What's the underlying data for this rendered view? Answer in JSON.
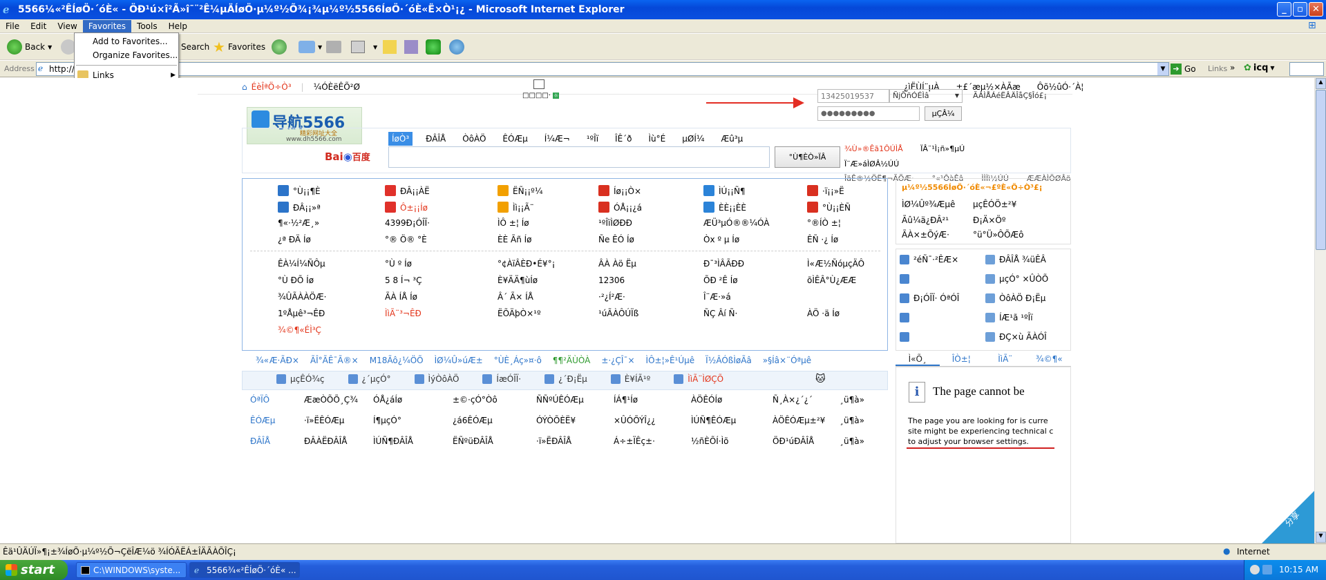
{
  "window": {
    "title": "5566¼«²ÊÍøÖ·´óÈ« - ÖÐ¹ú×î²Ã»î¯¨²Ê¼µÄÍøÖ·µ¼º½Õ¾¡¾µ¼º½5566ÍøÖ·´óÈ«Ë×Ò¹¡¿ - Microsoft Internet Explorer",
    "buttons": [
      "_",
      "▫",
      "✕"
    ]
  },
  "menu": [
    "File",
    "Edit",
    "View",
    "Favorites",
    "Tools",
    "Help"
  ],
  "favorites_menu": {
    "items": [
      "Add to Favorites...",
      "Organize Favorites...",
      "Links"
    ]
  },
  "toolbar": {
    "back": "Back",
    "search": "Search",
    "favorites": "Favorites"
  },
  "address": {
    "label": "Address",
    "value": "http://",
    "go": "Go",
    "links": "Links",
    "icq": "icq"
  },
  "page": {
    "topnav": {
      "home": "ÉèÎªÖ÷Ò³",
      "fav": "¼ÓÈëÊÕ²Ø",
      "r1": "¿ìËÙÍ¨µÀ",
      "r2": "±£´æµ½×ÀÃæ",
      "r3": "Ôõ½ûÓ·´À¦"
    },
    "logo": {
      "main": "导航5566",
      "sub": "精彩网址大全",
      "url": "www.dh5566.com"
    },
    "weather": {
      "text": "□□□□·"
    },
    "login": {
      "user_placeholder": "13425019537",
      "select": "ÑjÕñÓÉÌâ",
      "pwd_value": "●●●●●●●●●",
      "btn": "µÇÂ¼",
      "right": "ÃÀÌÅÁéËÂÄÎåÇ§Îó£¡"
    },
    "search": {
      "tabs": [
        "ÍøÒ³",
        "ÐÂÎÅ",
        "ÒôÀÖ",
        "ÊÓÆµ",
        "Í¼Æ¬",
        "¹ºÎï",
        "ÎÊ´ð",
        "Ìù°É",
        "µØÍ¼",
        "Æû³µ"
      ],
      "engine": "百度",
      "btn": "°Ù¶ÈÒ»ÏÂ",
      "hot1": "¾Ù»®Êã1ÔÚÌÅ",
      "hot2": "ÏÂ¨¹Ì¡ñ»¶µÚ",
      "hot3": "Ï¨Æ»áÌØÂ½ÚÚ",
      "hot4": "ÎäÊ®½ÖË¶¬ÃÕÆ·",
      "hot5": "°«¹ÔàÊâ",
      "hot6": "ÌÌÌì½ÚÚ",
      "hot7": "ÆÆÀÌÖØÂö"
    },
    "famous": {
      "rows": [
        [
          "°Ù¡¡¶È",
          "ÐÂ¡¡ÀË",
          "ËÑ¡¡º¼",
          "Íø¡¡Ò×",
          "ÌÚ¡¡Ñ¶",
          "·ï¡¡»Ë"
        ],
        [
          "ÐÂ¡¡»ª",
          "Ô±¡¡Íø",
          "Ìì¡¡Ã¨",
          "ÓÅ¡¡¿á",
          "ÈÈ¡¡ÈÈ",
          "°Ù¡¡ÈÑ"
        ],
        [
          "¶«·½²Æ¸»",
          "4399Ð¡ÓÎÏ·",
          "ÌÔ ±¦ Íø",
          "¹ºÎïÌØÐÐ",
          "ÆÜ³µÓ®®¼ÓÀ",
          "°®ÍÒ ±¦"
        ],
        [
          "¿ª ÐÄ Íø",
          "°® Ö® °È",
          "ÈÈ Ãñ Íø",
          "Ñe ÊÓ Íø",
          "Òx º µ Íø",
          "ÊÑ ·¿ Íø"
        ]
      ],
      "rows2": [
        [
          "ÊÀ¼Í¼ÑÔµ",
          "°Ù º Íø",
          "°¢ÀïÂÈÐ•É¥°¡",
          "ÂÀ Àö Ëµ",
          "Ð¯³ÌÂÃÐÐ",
          "Ì«Æ½ÑóµçÄÔ"
        ],
        [
          "°Ù ÐÕ Íø",
          "5 8 Í¬ ³Ç",
          "È¥ÄÄ¶ùÍø",
          "12306",
          "ÕÐ ²Ê Íø",
          "õÌÊÂ°Ù¿ÆÆ"
        ],
        [
          "¾ÛÃÀÀÖÆ·",
          "ÃÀ ÍÅ Íø",
          "Â´ Ã× ÍÅ",
          "·²¿Í²Æ·",
          "Î¨Æ·»á",
          ""
        ],
        [
          "1ºÅµê³¬ÊÐ",
          "ÌìÃ¨³¬ÊÐ",
          "ËÕÄþÒ×¹º",
          "¹úÃÀÔÚÏß",
          "ÑÇ Âí Ñ·",
          "ÀÖ ·ä Íø"
        ],
        [
          "¾©¶«ÉÌ³Ç",
          "",
          "",
          "",
          "",
          ""
        ]
      ]
    },
    "catbar": [
      "¾«Æ·ÃÐ×",
      "ÃÎ°ÃÊ¯Ã®×",
      "M18Ãô¿¼ÖÕ",
      "ÌØ¼Û»úÆ±",
      "°ÙÈ¸Áç»¤·ô",
      "¶¶²ÄÙÒÀ",
      "±·¿ÇÎ¯×",
      "ÌÔ±¦»Ê¹Úµê",
      "Ï½ÂÓßÌøÃâ",
      "»§Íâ×¨Óªµê"
    ],
    "tabs2": [
      "µçÊÓ¾ç",
      "¿´µçÓ°",
      "ÌýÒôÀÖ",
      "ÍæÓÎÏ·",
      "¿´Ð¡Ëµ",
      "È¥ÍÃ¹º",
      "ÌìÃ¨ÌØÇÕ"
    ],
    "list": [
      [
        "ÓªÏÔ",
        "ÆæÒÕÕ¸Ç¾",
        "ÓÅ¿áÍø",
        "±©·çÓ°Òô",
        "ÑÑºÚÊÓÆµ",
        "ÍÁ¶¹Íø",
        "ÀÖÊÓÍø",
        "Ñ¸À×¿´¿´",
        "¸ü¶à»"
      ],
      [
        "ÊÓÆµ",
        "·ï»ËÊÓÆµ",
        "Í¶µçÓ°",
        "¿á6ÊÓÆµ",
        "ÓÝÒÕÈË¥",
        "×ÛÓÕÝÎ¿¿",
        "ÌÚÑ¶ÊÓÆµ",
        "ÀÖÊÓÆµ±²¥",
        "¸ü¶à»"
      ],
      [
        "ÐÂÎÅ",
        "ÐÂÀËÐÂÎÅ",
        "ÌÚÑ¶ÐÂÎÅ",
        "ËÑºüÐÂÎÅ",
        "·ï»ËÐÂÎÅ",
        "Á÷±ÏÊç±·",
        "½ñÈÕÍ·Ìõ",
        "ÖÐ¹úÐÂÎÅ",
        "¸ü¶à»"
      ]
    ],
    "side": {
      "hdr": "µ¼º½5566ÍøÖ·´óÈ«¬£ºÈ«Ö÷Ò³£¡",
      "l1": "ÌØ¼Ûº¾Æµê",
      "l2": "µçÊÓÖ±²¥",
      "l3": "Ãû¼ä¿ÐÂ²¹",
      "l4": "Ð¡Ä×Öº",
      "l5": "ÃÀ×±ÕýÆ·",
      "l6": "°ü°Ü»ÔÕÆô",
      "tools": [
        [
          "²éÑ¯·²ÊÆ×",
          "ÐÂÎÅ ¾üÊÂ"
        ],
        [
          "",
          "µçÓ° ×ÛÒÕ"
        ],
        [
          "Ð¡ÓÎÏ· ÓªÓÎ",
          "ÒôÀÖ Ð¡Ëµ"
        ],
        [
          "",
          "ÍÆ¹ã ¹ºÎï"
        ],
        [
          "",
          "ÐÇ×ù ÃÀÓÎ"
        ]
      ],
      "stabs": [
        "Ì«Õ¸",
        "ÎÒ±¦",
        "ÌìÃ¨",
        "¾©¶«"
      ],
      "error_title": "The page cannot be",
      "error_body1": "The page you are looking for is curre",
      "error_body2": "site might be experiencing technical c",
      "error_body3": "to adjust your browser settings.",
      "share": "分享"
    }
  },
  "status": {
    "text": "Êä¹ÛÄÚÏ»¶¡±¾ÍøÕ·µ¼º½Õ¬ÇëÎÆ¼ö ¾ÍÓÃËÁ±ÎÄÃÀÕÎÇ¡",
    "zone": "Internet"
  },
  "taskbar": {
    "start": "start",
    "task1": "C:\\WINDOWS\\syste...",
    "task2": "5566¾«²ÊÍøÖ·´óÈ« ...",
    "time": "10:15 AM"
  }
}
